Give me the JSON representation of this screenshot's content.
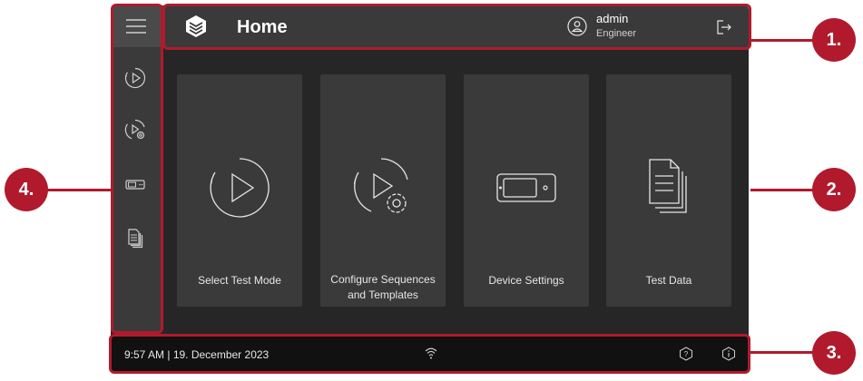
{
  "header": {
    "title": "Home",
    "user_name": "admin",
    "user_role": "Engineer"
  },
  "tiles": [
    {
      "label": "Select Test Mode",
      "icon": "play-icon"
    },
    {
      "label": "Configure Sequences and Templates",
      "icon": "play-gear-icon"
    },
    {
      "label": "Device Settings",
      "icon": "device-icon"
    },
    {
      "label": "Test Data",
      "icon": "documents-icon"
    }
  ],
  "footer": {
    "datetime": "9:57 AM | 19. December 2023"
  },
  "callouts": {
    "c1": "1.",
    "c2": "2.",
    "c3": "3.",
    "c4": "4."
  },
  "colors": {
    "accent": "#b11a2c",
    "background": "#262626",
    "panel": "#3a3a3a",
    "footer": "#111111"
  }
}
